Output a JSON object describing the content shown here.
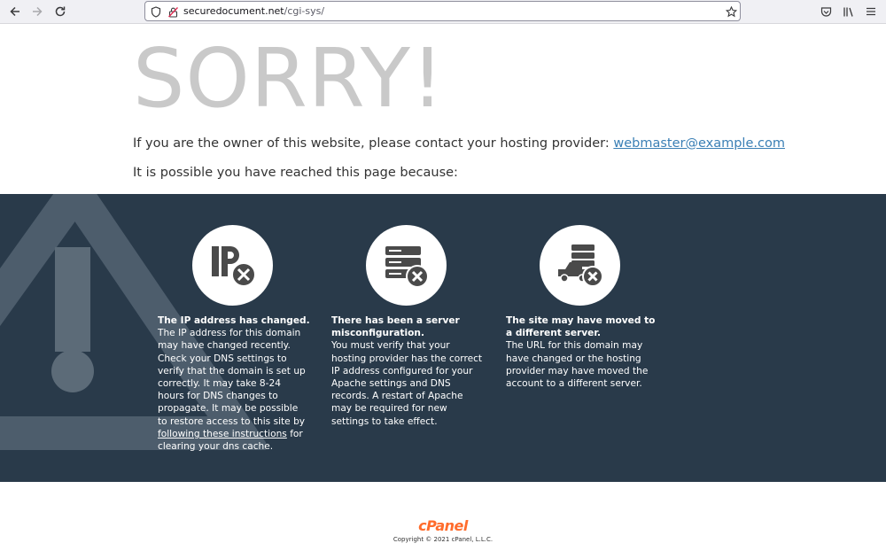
{
  "browser": {
    "url_domain": "securedocument.net",
    "url_path": "/cgi-sys/"
  },
  "page": {
    "heading": "SORRY!",
    "owner_text": "If you are the owner of this website, please contact your hosting provider: ",
    "contact_email": "webmaster@example.com",
    "reason_intro": "It is possible you have reached this page because:"
  },
  "reasons": [
    {
      "icon": "ip-changed-icon",
      "title": "The IP address has changed.",
      "body_before_link": "The IP address for this domain may have changed recently. Check your DNS settings to verify that the domain is set up correctly. It may take 8-24 hours for DNS changes to propagate. It may be possible to restore access to this site by ",
      "link_text": "following these instructions",
      "body_after_link": " for clearing your dns cache."
    },
    {
      "icon": "server-misconfig-icon",
      "title": "There has been a server misconfiguration.",
      "body": "You must verify that your hosting provider has the correct IP address configured for your Apache settings and DNS records. A restart of Apache may be required for new settings to take effect."
    },
    {
      "icon": "server-moved-icon",
      "title": "The site may have moved to a different server.",
      "body": "The URL for this domain may have changed or the hosting provider may have moved the account to a different server."
    }
  ],
  "footer": {
    "logo_text": "cPanel",
    "copyright": "Copyright © 2021 cPanel, L.L.C."
  },
  "colors": {
    "band": "#293a4a",
    "link": "#3a7fb5",
    "heading": "#c9c9c9",
    "brand": "#ff6c2c"
  }
}
